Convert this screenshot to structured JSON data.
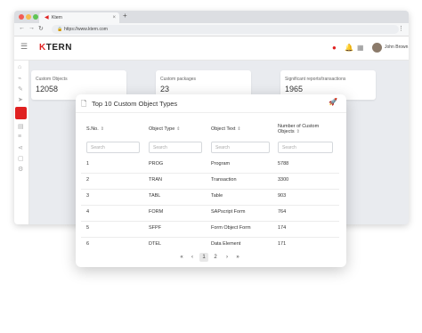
{
  "browser": {
    "tab_title": "Ktern",
    "tab_close": "×",
    "new_tab": "+",
    "url": "https://www.ktern.com"
  },
  "app": {
    "logo_k": "K",
    "logo_rest": "TERN",
    "user_name": "John Brown"
  },
  "cards": [
    {
      "label": "Custom Objects",
      "value": "12058"
    },
    {
      "label": "Custom packages",
      "value": "23"
    },
    {
      "label": "Significant reports/transactions",
      "value": "1965"
    }
  ],
  "panel": {
    "title": "Top 10 Custom Object Types",
    "columns": [
      "S.No.",
      "Object Type",
      "Object Text",
      "Number of Custom Objects"
    ],
    "search_placeholder": "Search",
    "rows": [
      {
        "sno": "1",
        "type": "PROG",
        "text": "Program",
        "count": "5788"
      },
      {
        "sno": "2",
        "type": "TRAN",
        "text": "Transaction",
        "count": "3300"
      },
      {
        "sno": "3",
        "type": "TABL",
        "text": "Table",
        "count": "903"
      },
      {
        "sno": "4",
        "type": "FORM",
        "text": "SAPscript Form",
        "count": "764"
      },
      {
        "sno": "5",
        "type": "SFPF",
        "text": "Form Object Form",
        "count": "174"
      },
      {
        "sno": "6",
        "type": "DTEL",
        "text": "Data Element",
        "count": "171"
      }
    ],
    "pagination": {
      "first": "«",
      "prev": "‹",
      "page1": "1",
      "page2": "2",
      "next": "›",
      "last": "»"
    }
  },
  "colors": {
    "accent": "#e02020",
    "background": "#e9ebef"
  }
}
